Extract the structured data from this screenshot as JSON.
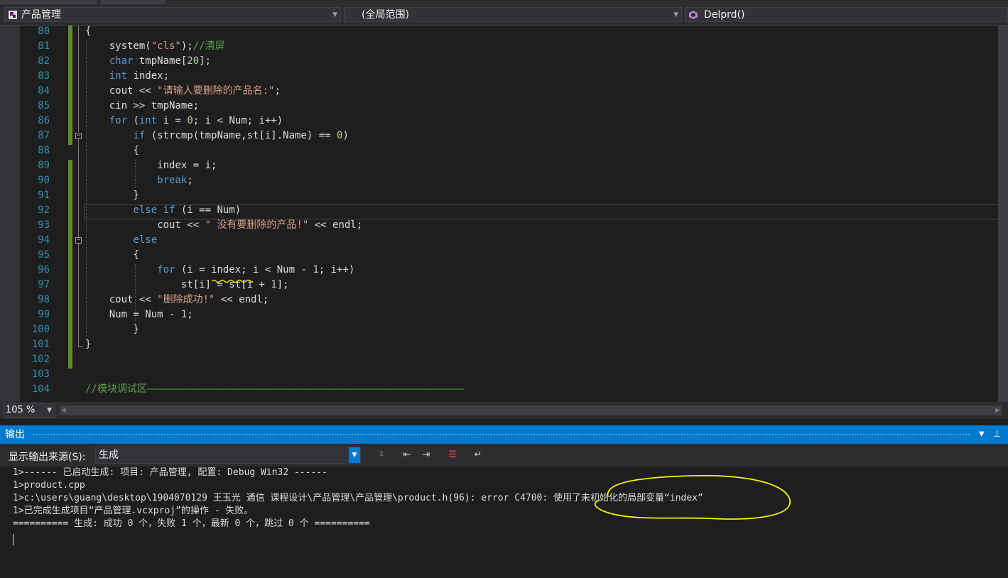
{
  "navbar": {
    "project_combo": "产品管理",
    "scope_combo": "(全局范围)",
    "function_combo": "Delprd()"
  },
  "editor": {
    "lines": [
      {
        "n": "80",
        "segs": [
          [
            "p",
            "{"
          ]
        ]
      },
      {
        "n": "81",
        "segs": [
          [
            "p",
            "    system("
          ],
          [
            "str",
            "\"cls\""
          ],
          [
            "p",
            ");"
          ],
          [
            "cm",
            "//清屏"
          ]
        ]
      },
      {
        "n": "82",
        "segs": [
          [
            "p",
            "    "
          ],
          [
            "kw",
            "char"
          ],
          [
            "p",
            " tmpName["
          ],
          [
            "num",
            "20"
          ],
          [
            "p",
            "];"
          ]
        ]
      },
      {
        "n": "83",
        "segs": [
          [
            "p",
            "    "
          ],
          [
            "kw",
            "int"
          ],
          [
            "p",
            " index;"
          ]
        ]
      },
      {
        "n": "84",
        "segs": [
          [
            "p",
            "    cout << "
          ],
          [
            "str",
            "\"请输人要删除的产品名:\""
          ],
          [
            "p",
            ";"
          ]
        ]
      },
      {
        "n": "85",
        "segs": [
          [
            "p",
            "    cin >> tmpName;"
          ]
        ]
      },
      {
        "n": "86",
        "segs": [
          [
            "p",
            "    "
          ],
          [
            "kw",
            "for"
          ],
          [
            "p",
            " ("
          ],
          [
            "kw",
            "int"
          ],
          [
            "p",
            " i = "
          ],
          [
            "num",
            "0"
          ],
          [
            "p",
            "; i < Num; i++)"
          ]
        ]
      },
      {
        "n": "87",
        "segs": [
          [
            "p",
            "        "
          ],
          [
            "kw",
            "if"
          ],
          [
            "p",
            " (strcmp(tmpName,st[i].Name) == "
          ],
          [
            "num",
            "0"
          ],
          [
            "p",
            ")"
          ]
        ]
      },
      {
        "n": "88",
        "segs": [
          [
            "p",
            "        {"
          ]
        ]
      },
      {
        "n": "89",
        "segs": [
          [
            "p",
            "            index = i;"
          ]
        ]
      },
      {
        "n": "90",
        "segs": [
          [
            "p",
            "            "
          ],
          [
            "kw",
            "break"
          ],
          [
            "p",
            ";"
          ]
        ]
      },
      {
        "n": "91",
        "segs": [
          [
            "p",
            "        }"
          ]
        ]
      },
      {
        "n": "92",
        "segs": [
          [
            "p",
            "        "
          ],
          [
            "kw",
            "else"
          ],
          [
            "p",
            " "
          ],
          [
            "kw",
            "if"
          ],
          [
            "p",
            " (i == Num)"
          ]
        ]
      },
      {
        "n": "93",
        "segs": [
          [
            "p",
            "            cout << "
          ],
          [
            "str",
            "\" 没有要删除的产品!\""
          ],
          [
            "p",
            " << endl;"
          ]
        ]
      },
      {
        "n": "94",
        "segs": [
          [
            "p",
            "        "
          ],
          [
            "kw",
            "else"
          ]
        ]
      },
      {
        "n": "95",
        "segs": [
          [
            "p",
            "        {"
          ]
        ]
      },
      {
        "n": "96",
        "segs": [
          [
            "p",
            "            "
          ],
          [
            "kw",
            "for"
          ],
          [
            "p",
            " (i = index; i < Num - "
          ],
          [
            "num",
            "1"
          ],
          [
            "p",
            "; i++)"
          ]
        ]
      },
      {
        "n": "97",
        "segs": [
          [
            "p",
            "                st[i] = st[i + "
          ],
          [
            "num",
            "1"
          ],
          [
            "p",
            "];"
          ]
        ]
      },
      {
        "n": "98",
        "segs": [
          [
            "p",
            "    cout << "
          ],
          [
            "str",
            "\"删除成功!\""
          ],
          [
            "p",
            " << endl;"
          ]
        ]
      },
      {
        "n": "99",
        "segs": [
          [
            "p",
            "    Num = Num - "
          ],
          [
            "num",
            "1"
          ],
          [
            "p",
            ";"
          ]
        ]
      },
      {
        "n": "100",
        "segs": [
          [
            "p",
            "        }"
          ]
        ]
      },
      {
        "n": "101",
        "segs": [
          [
            "p",
            "}"
          ]
        ]
      },
      {
        "n": "102",
        "segs": []
      },
      {
        "n": "103",
        "segs": []
      },
      {
        "n": "104",
        "segs": [
          [
            "cm",
            "//模块调试区—————————————————————————————————————————————————————"
          ]
        ]
      }
    ]
  },
  "status": {
    "zoom": "105 %"
  },
  "output": {
    "title": "输出",
    "source_label": "显示输出来源(S):",
    "source_value": "生成",
    "lines": [
      "1>------ 已启动生成: 项目: 产品管理, 配置: Debug Win32 ------",
      "1>product.cpp",
      "1>c:\\users\\guang\\desktop\\1904070129 王玉光 通信 课程设计\\产品管理\\产品管理\\product.h(96): error C4700: 使用了未初始化的局部变量“index”",
      "1>已完成生成项目“产品管理.vcxproj”的操作 - 失败。",
      "========== 生成: 成功 0 个，失败 1 个，最新 0 个，跳过 0 个 =========="
    ]
  },
  "colors": {
    "keyword": "#569cd6",
    "string": "#d69d85",
    "comment": "#57a64a",
    "line_number": "#2b91af",
    "accent": "#007acc",
    "annotation": "#f5f500"
  }
}
